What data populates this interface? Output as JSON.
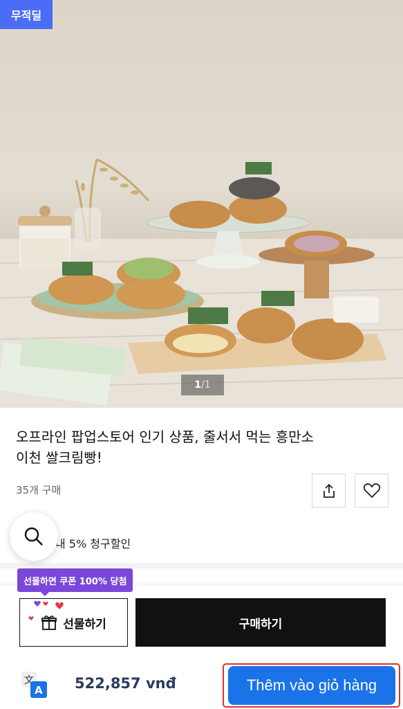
{
  "hero": {
    "badge": "무적딜",
    "pager_current": "1",
    "pager_separator": " / ",
    "pager_total": "1"
  },
  "product": {
    "title_line1": "오프라인 팝업스토어 인기 상품, 줄서서 먹는 흥만소",
    "title_line2": "이천 쌀크림빵!",
    "purchase_count": "35개 구매"
  },
  "actions": {
    "share_icon": "share-icon",
    "wish_icon": "heart-outline-icon"
  },
  "discount": {
    "text": "내 5% 청구할인"
  },
  "search": {
    "icon": "search-icon"
  },
  "cta": {
    "tooltip": "선물하면 쿠폰 100% 당첨",
    "gift_label": "선물하기",
    "buy_label": "구매하기"
  },
  "footer": {
    "price": "522,857 vnđ",
    "cart_label": "Thêm vào giỏ hàng",
    "translate_icon": "translate-icon"
  },
  "colors": {
    "badge": "#4a6cf7",
    "tooltip": "#7b47d9",
    "buy": "#111111",
    "cart": "#1a73e8",
    "highlight_outline": "#d9312c",
    "price": "#2b3b5c"
  }
}
